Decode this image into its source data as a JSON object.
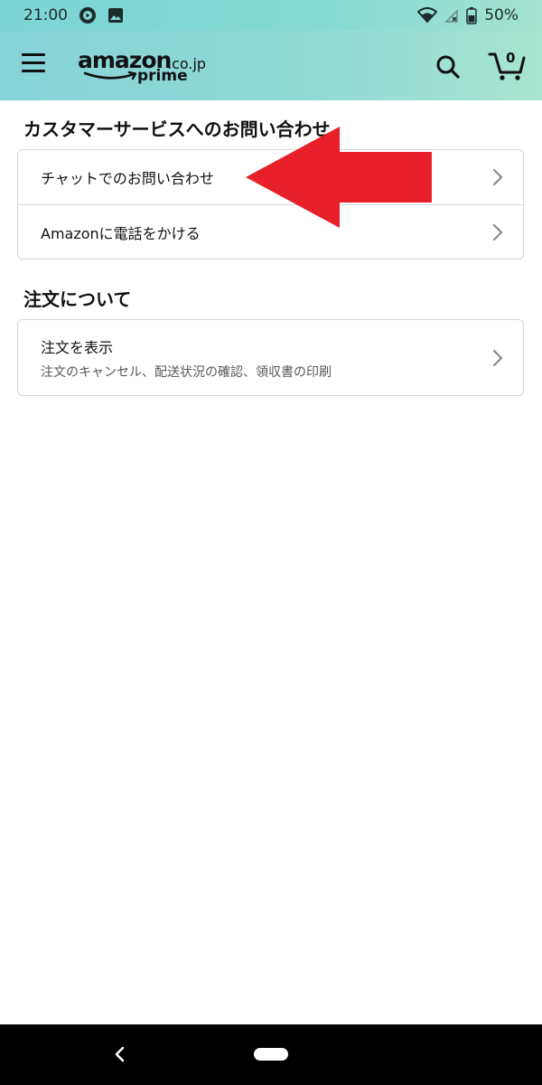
{
  "status_bar": {
    "time": "21:00",
    "battery": "50%"
  },
  "header": {
    "logo_text": "amazon",
    "logo_suffix": ".co.jp",
    "logo_prime": "prime",
    "cart_count": "0"
  },
  "customer_service": {
    "title": "カスタマーサービスへのお問い合わせ",
    "items": [
      {
        "label": "チャットでのお問い合わせ"
      },
      {
        "label": "Amazonに電話をかける"
      }
    ]
  },
  "orders": {
    "title": "注文について",
    "items": [
      {
        "label": "注文を表示",
        "sublabel": "注文のキャンセル、配送状況の確認、領収書の印刷"
      }
    ]
  },
  "colors": {
    "arrow": "#e8202a",
    "header_start": "#86d3d8",
    "header_end": "#a8e5d0"
  }
}
